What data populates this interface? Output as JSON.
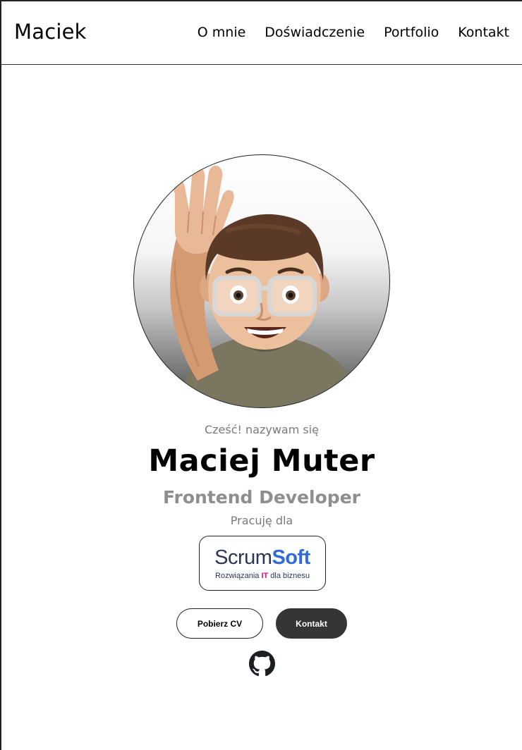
{
  "header": {
    "logo": "Maciek",
    "nav": [
      "O mnie",
      "Doświadczenie",
      "Portfolio",
      "Kontakt"
    ]
  },
  "hero": {
    "greeting": "Cześć! nazywam się",
    "name": "Maciej Muter",
    "role": "Frontend Developer",
    "work_for": "Pracuję dla",
    "company": {
      "name_part1": "Scrum",
      "name_part2": "Soft",
      "tagline_pre": "Rozwiązania ",
      "tagline_highlight": "IT",
      "tagline_post": " dla biznesu",
      "colors": {
        "primary": "#2c3656",
        "accent": "#2f6bd9",
        "highlight": "#d4157a"
      }
    },
    "buttons": {
      "cv": "Pobierz CV",
      "contact": "Kontakt"
    },
    "avatar_icon": "waving-memoji-avatar",
    "social_icon": "github-icon"
  },
  "colors": {
    "text": "#000000",
    "muted": "#7a7a7a",
    "role": "#8e8e8e",
    "button_dark": "#353535"
  }
}
